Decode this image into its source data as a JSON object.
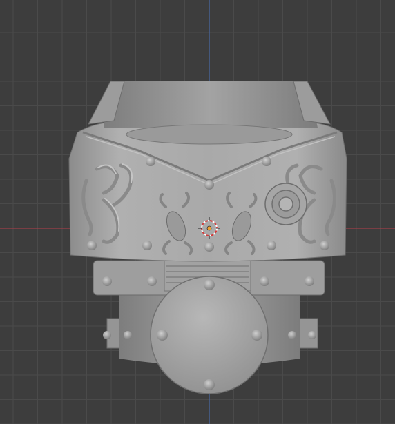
{
  "viewport": {
    "background": "#3d3d3d",
    "grid_color": "#4a4a4a",
    "x_axis_color": "#a0404a",
    "z_axis_color": "#4a6aa8"
  },
  "scene": {
    "object": "armor-torso-mesh",
    "mesh_color": "#a8a8a8",
    "origin_marker": "3d-cursor-icon"
  }
}
